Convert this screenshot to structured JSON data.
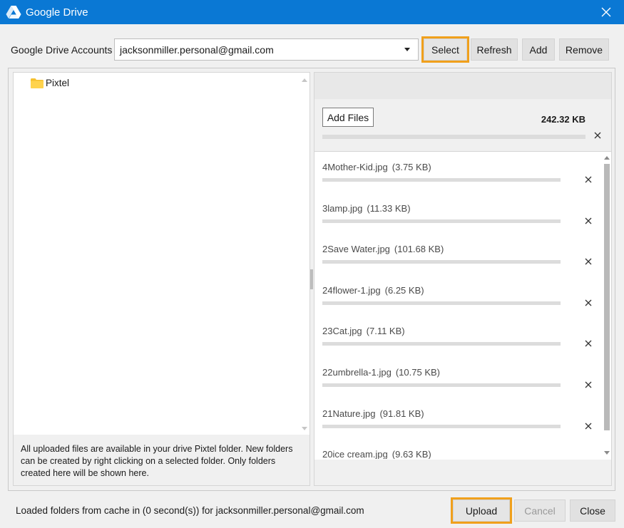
{
  "window": {
    "title": "Google Drive",
    "accent": "#0a78d4",
    "highlight": "#f0a01c"
  },
  "accounts": {
    "label": "Google Drive Accounts",
    "selected": "jacksonmiller.personal@gmail.com",
    "select_label": "Select",
    "refresh_label": "Refresh",
    "add_label": "Add",
    "remove_label": "Remove"
  },
  "tree": {
    "items": [
      {
        "label": "Pixtel",
        "icon": "folder-icon"
      }
    ]
  },
  "info": {
    "text": "All uploaded files are available in your drive Pixtel folder. New folders can be created by right clicking on a selected folder. Only folders created here will be shown here."
  },
  "upload_panel": {
    "add_files_label": "Add Files",
    "total_size": "242.32 KB",
    "total_progress": 0,
    "files": [
      {
        "name": "4Mother-Kid.jpg",
        "size": "(3.75 KB)",
        "progress": 0
      },
      {
        "name": "3lamp.jpg",
        "size": "(11.33 KB)",
        "progress": 0
      },
      {
        "name": "2Save Water.jpg",
        "size": "(101.68 KB)",
        "progress": 0
      },
      {
        "name": "24flower-1.jpg",
        "size": "(6.25 KB)",
        "progress": 0
      },
      {
        "name": "23Cat.jpg",
        "size": "(7.11 KB)",
        "progress": 0
      },
      {
        "name": "22umbrella-1.jpg",
        "size": "(10.75 KB)",
        "progress": 0
      },
      {
        "name": "21Nature.jpg",
        "size": "(91.81 KB)",
        "progress": 0
      },
      {
        "name": "20ice cream.jpg",
        "size": "(9.63 KB)",
        "progress": 0
      }
    ]
  },
  "footer": {
    "status": "Loaded folders from cache in (0 second(s)) for jacksonmiller.personal@gmail.com",
    "upload_label": "Upload",
    "cancel_label": "Cancel",
    "close_label": "Close"
  }
}
